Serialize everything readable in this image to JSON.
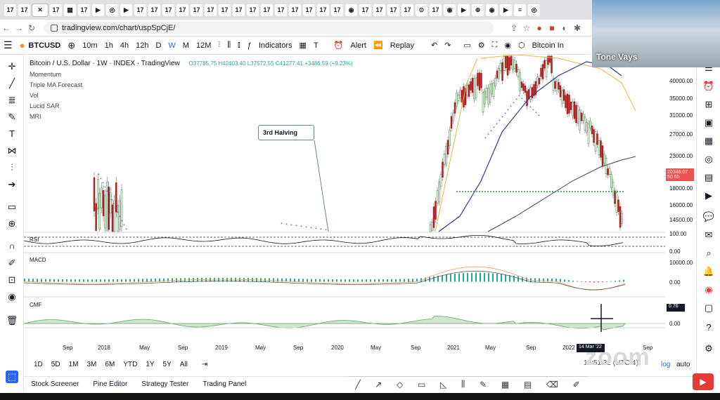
{
  "browser": {
    "url": "tradingview.com/chart/uspSpCjE/"
  },
  "toolbar": {
    "symbol": "BTCUSD",
    "intervals": [
      "10m",
      "1h",
      "4h",
      "12h",
      "D",
      "W",
      "M",
      "12M"
    ],
    "indicators_label": "Indicators",
    "alert_label": "Alert",
    "replay_label": "Replay",
    "compare_label": "Bitcoin In"
  },
  "legend": {
    "title": "Bitcoin / U.S. Dollar · 1W · INDEX · TradingView",
    "ohlc": "O37785.75 H42403.40 L37572.55 C41277.41 +3486.59 (+9.23%)",
    "indicators": [
      "Momentum",
      "Triple MA Forecast",
      "Vol",
      "Lucid SAR",
      "MRI"
    ]
  },
  "annotation": "3rd Halving",
  "price_scale": [
    "40000.00",
    "35000.00",
    "31000.00",
    "27000.00",
    "23000.00",
    "20348.07",
    "50 6h",
    "18000.00",
    "16000.00",
    "14500.00"
  ],
  "pane_labels": {
    "rsi": "RSI",
    "macd": "MACD",
    "cmf": "CMF"
  },
  "pane_scales": {
    "rsi": [
      "100.00",
      "0.00"
    ],
    "macd": [
      "10000.00",
      "0.00"
    ],
    "cmf": [
      "0.76",
      "0.00"
    ]
  },
  "date_scale": [
    "Sep",
    "2018",
    "May",
    "Sep",
    "2019",
    "May",
    "Sep",
    "2020",
    "May",
    "Sep",
    "2021",
    "May",
    "Sep",
    "2022",
    "Sep"
  ],
  "crosshair_date": "14 Mar '22",
  "timeframes": [
    "1D",
    "5D",
    "1M",
    "3M",
    "6M",
    "YTD",
    "1Y",
    "5Y",
    "All"
  ],
  "clock": "14:51:32 (UTC-4)",
  "log_label": "log",
  "auto_label": "auto",
  "panels": [
    "Stock Screener",
    "Pine Editor",
    "Strategy Tester",
    "Trading Panel"
  ],
  "webcam": {
    "name": "Tone Vays"
  },
  "zoom_watermark": "zoom"
}
